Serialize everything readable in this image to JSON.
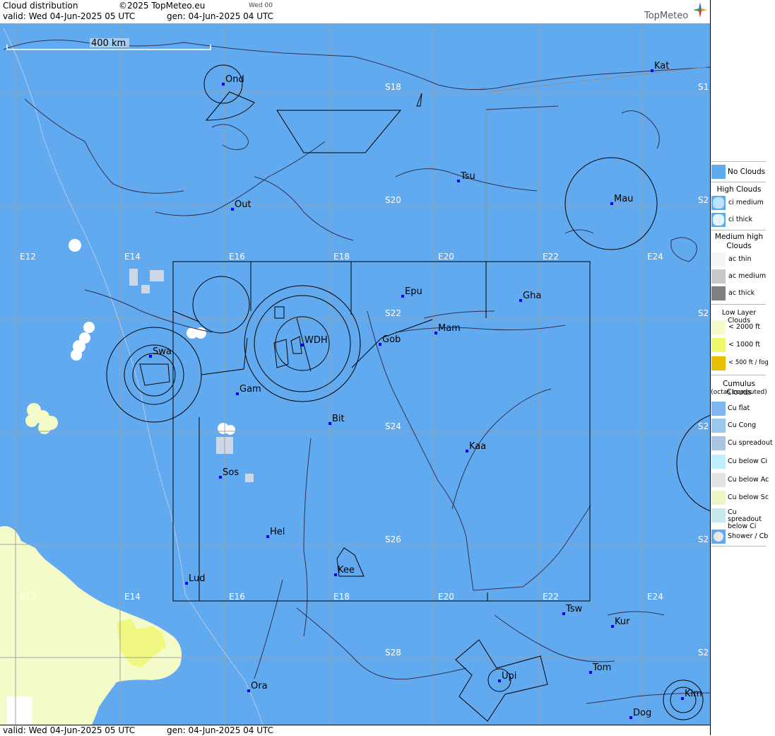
{
  "header": {
    "title": "Cloud distribution",
    "copyright": "©2025 TopMeteo.eu",
    "run": "Wed 00",
    "valid": "valid:  Wed  04-Jun-2025  05 UTC",
    "gen": "gen: 04-Jun-2025 04 UTC",
    "brand": "TopMeteo"
  },
  "footer": {
    "valid": "valid:  Wed  04-Jun-2025  05 UTC",
    "gen": "gen: 04-Jun-2025 04 UTC"
  },
  "scale": {
    "label": "400 km"
  },
  "colors": {
    "ocean_land": "#62aaf0",
    "low_cloud": "#f4fbc8",
    "low_cloud_1000": "#f0f76a",
    "grid": "#a0a0a0"
  },
  "grid_labels": {
    "lon_top": [
      "E12",
      "E14",
      "E16",
      "E18",
      "E20",
      "E22",
      "E24"
    ],
    "lon_bottom": [
      "E12",
      "E14",
      "E16",
      "E18",
      "E20",
      "E22",
      "E24"
    ],
    "lat_center": [
      "S18",
      "S20",
      "S22",
      "S24",
      "S26",
      "S28"
    ],
    "lat_right": [
      "S1",
      "S2",
      "S2",
      "S2",
      "S2",
      "S2"
    ]
  },
  "cities": [
    {
      "name": "Ond"
    },
    {
      "name": "Kat"
    },
    {
      "name": "Tsu"
    },
    {
      "name": "Mau"
    },
    {
      "name": "Out"
    },
    {
      "name": "Epu"
    },
    {
      "name": "Gha"
    },
    {
      "name": "Mam"
    },
    {
      "name": "Swa"
    },
    {
      "name": "WDH"
    },
    {
      "name": "Gob"
    },
    {
      "name": "Gam"
    },
    {
      "name": "Bit"
    },
    {
      "name": "Kaa"
    },
    {
      "name": "Sos"
    },
    {
      "name": "Hel"
    },
    {
      "name": "Kee"
    },
    {
      "name": "Lud"
    },
    {
      "name": "Tsw"
    },
    {
      "name": "Kur"
    },
    {
      "name": "Tom"
    },
    {
      "name": "Upi"
    },
    {
      "name": "Ora"
    },
    {
      "name": "Kim"
    },
    {
      "name": "Dog"
    }
  ],
  "legend": {
    "no_clouds": "No Clouds",
    "high_title": "High Clouds",
    "high": [
      "ci medium",
      "ci thick"
    ],
    "medium_title": "Medium high Clouds",
    "medium": [
      "ac thin",
      "ac medium",
      "ac thick"
    ],
    "low_title": "Low Layer Clouds",
    "low": [
      "< 2000 ft",
      "< 1000 ft",
      "< 500 ft / fog"
    ],
    "cu_title": "Cumulus Clouds",
    "cu_sub": "(octas computed)",
    "cu": [
      "Cu flat",
      "Cu Cong",
      "Cu spreadout",
      "Cu below Ci",
      "Cu below Ac",
      "Cu below Sc",
      "Cu spreadout below Ci",
      "Shower / Cb"
    ]
  }
}
